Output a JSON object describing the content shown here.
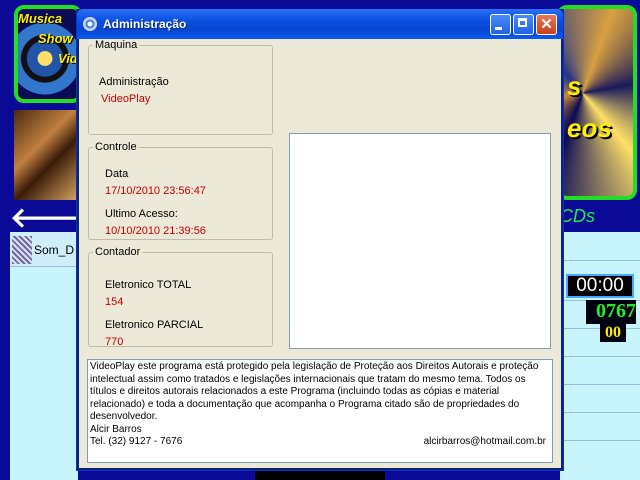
{
  "background": {
    "banner_left_lines": [
      "Musica",
      "Show",
      "Vid"
    ],
    "banner_right_lines": [
      "s",
      "eos"
    ],
    "list_item_label": "Som_D",
    "cds_label": "CDs",
    "timer": "00:00",
    "counter_main": "0767",
    "counter_sub": "00",
    "back_arrow": "🡐"
  },
  "window": {
    "title": "Administração",
    "close_glyph": "✕"
  },
  "maquina": {
    "legend": "Maquina",
    "label": "Administração",
    "value": "VideoPlay"
  },
  "controle": {
    "legend": "Controle",
    "data_label": "Data",
    "data_value": "17/10/2010 23:56:47",
    "ultimo_label": "Ultimo Acesso:",
    "ultimo_value": "10/10/2010 21:39:56"
  },
  "contador": {
    "legend": "Contador",
    "total_label": "Eletronico TOTAL",
    "total_value": "154",
    "parcial_label": "Eletronico PARCIAL",
    "parcial_value": "770"
  },
  "notice": {
    "text": "VideoPlay este programa está protegido pela legislação de Proteção aos Direitos Autorais e proteção intelectual assim como tratados e legislações internacionais que tratam do mesmo tema. Todos os títulos e direitos autorais relacionados a este Programa (incluindo todas as cópias e material relacionado) e toda a documentação que acompanha o Programa citado são de propriedades do desenvolvedor.",
    "author": "Alcir Barros",
    "phone": "Tel. (32) 9127 - 7676",
    "email": "alcirbarros@hotmail.com.br"
  },
  "colors": {
    "value_red": "#c80000",
    "titlebar_blue": "#0a4fe0",
    "background_navy": "#0a0a96"
  }
}
